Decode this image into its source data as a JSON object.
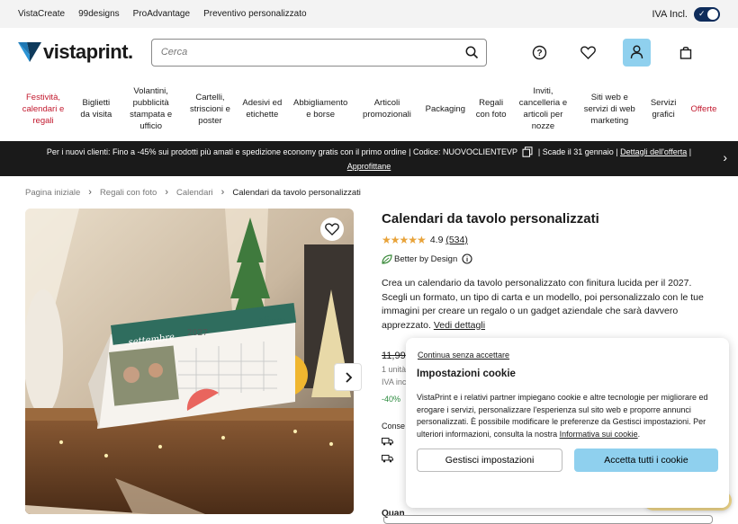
{
  "topbar": {
    "links": [
      "VistaCreate",
      "99designs",
      "ProAdvantage",
      "Preventivo personalizzato"
    ],
    "vat_label": "IVA Incl."
  },
  "header": {
    "logo_text": "vistaprint.",
    "search_placeholder": "Cerca"
  },
  "nav": {
    "items": [
      {
        "label": "Festività, calendari e regali",
        "color": "#c2192e"
      },
      {
        "label": "Biglietti da visita"
      },
      {
        "label": "Volantini, pubblicità stampata e ufficio"
      },
      {
        "label": "Cartelli, striscioni e poster"
      },
      {
        "label": "Adesivi ed etichette"
      },
      {
        "label": "Abbigliamento e borse"
      },
      {
        "label": "Articoli promozionali"
      },
      {
        "label": "Packaging"
      },
      {
        "label": "Regali con foto"
      },
      {
        "label": "Inviti, cancelleria e articoli per nozze"
      },
      {
        "label": "Siti web e servizi di web marketing"
      },
      {
        "label": "Servizi grafici"
      },
      {
        "label": "Offerte",
        "color": "#c2192e"
      }
    ]
  },
  "promo": {
    "text": "Per i nuovi clienti: Fino a -45% sui prodotti più amati e spedizione economy gratis con il primo ordine | Codice: NUOVOCLIENTEVP",
    "deadline": "| Scade il 31 gennaio |",
    "details_link": "Dettagli dell'offerta",
    "cta": "Approfittane"
  },
  "breadcrumb": [
    "Pagina iniziale",
    "Regali con foto",
    "Calendari",
    "Calendari da tavolo personalizzati"
  ],
  "product": {
    "title": "Calendari da tavolo personalizzati",
    "rating": "4.9",
    "review_count": "(534)",
    "rating_value": 4.9,
    "badge": "Better by Design",
    "description": "Crea un calendario da tavolo personalizzato con finitura lucida per il 2027. Scegli un formato, un tipo di carta e un modello, poi personalizzalo con le tue immagini per creare un regalo o un gadget aziendale che sarà davvero apprezzato.",
    "details_link": "Vedi dettagli",
    "price": "11,99",
    "unit": "1 unità",
    "vat": "IVA inc",
    "discount": "-40%",
    "shipping_label": "Conse",
    "quantity_label": "Quan",
    "image_texts": {
      "brand": "elivra",
      "month": "settembre",
      "year": "2027"
    }
  },
  "cookie": {
    "skip": "Continua senza accettare",
    "title": "Impostazioni cookie",
    "body": "VistaPrint e i relativi partner impiegano cookie e altre tecnologie per migliorare ed erogare i servizi, personalizzare l'esperienza sul sito web e proporre annunci personalizzati. È possibile modificare le preferenze da Gestisci impostazioni. Per ulteriori informazioni, consulta la nostra",
    "policy_link": "Informativa sui cookie",
    "manage_btn": "Gestisci impostazioni",
    "accept_btn": "Accetta tutti i cookie"
  },
  "colors": {
    "accent": "#8fd0ee",
    "promo_bg": "#1a1a1a",
    "sale_red": "#c2192e",
    "star": "#e8a33a"
  }
}
